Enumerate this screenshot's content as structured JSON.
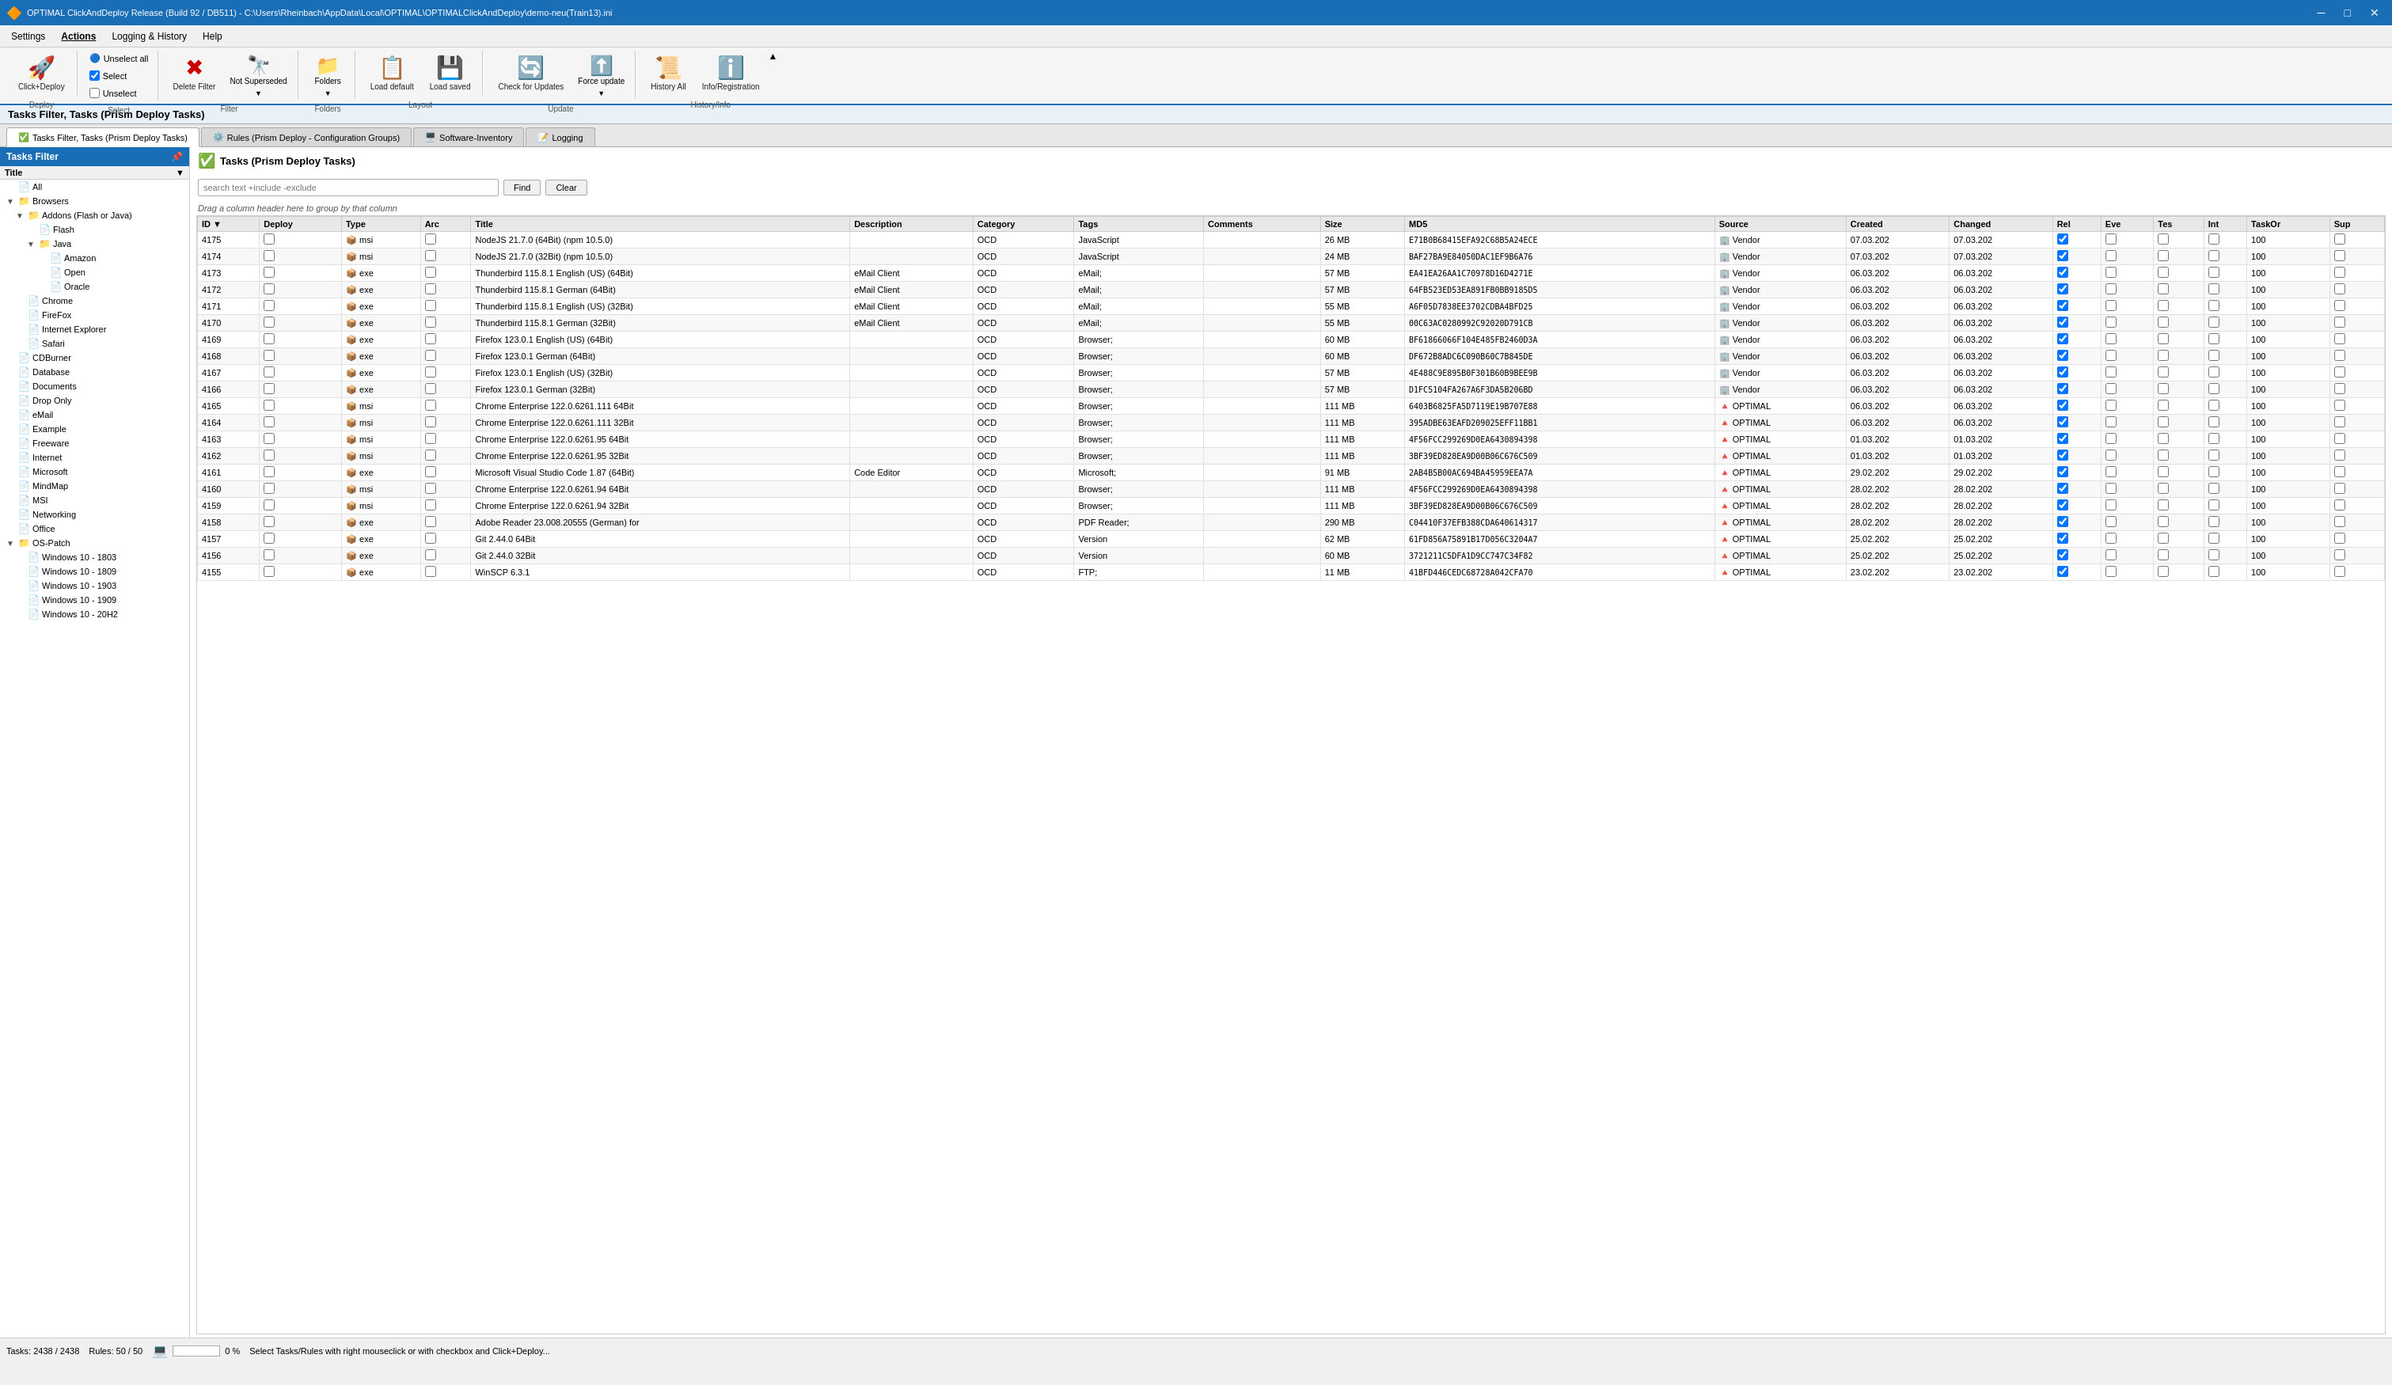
{
  "titlebar": {
    "icon": "🔶",
    "text": "OPTIMAL ClickAndDeploy Release (Build 92 / DB511) - C:\\Users\\Rheinbach\\AppData\\Local\\OPTIMAL\\OPTIMALClickAndDeploy\\demo-neu(Train13).ini",
    "minimize": "─",
    "maximize": "□",
    "close": "✕"
  },
  "menubar": {
    "items": [
      "Settings",
      "Actions",
      "Logging & History",
      "Help"
    ]
  },
  "toolbar": {
    "deploy_label": "Click+Deploy",
    "unselect_all_label": "Unselect all",
    "select_label": "Select",
    "unselect_label": "Unselect",
    "delete_filter_label": "Delete Filter",
    "not_superseded_label": "Not Superseded",
    "folders_label": "Folders",
    "load_default_label": "Load default",
    "load_saved_label": "Load saved",
    "check_updates_label": "Check for Updates",
    "force_update_label": "Force update",
    "history_all_label": "History All",
    "info_registration_label": "Info/Registration",
    "group_deploy": "Deploy",
    "group_select": "Select",
    "group_filter": "Filter",
    "group_folders": "Folders",
    "group_layout": "Layout",
    "group_update": "Update",
    "group_history_info": "History/Info"
  },
  "page_title": "Tasks Filter, Tasks (Prism Deploy Tasks)",
  "tabs": [
    {
      "label": "Tasks Filter, Tasks (Prism Deploy Tasks)",
      "active": true
    },
    {
      "label": "Rules (Prism Deploy - Configuration Groups)",
      "active": false
    },
    {
      "label": "Software-Inventory",
      "active": false
    },
    {
      "label": "Logging",
      "active": false
    }
  ],
  "sidebar": {
    "title": "Tasks Filter",
    "title_column": "Title",
    "items": [
      {
        "label": "All",
        "indent": 0,
        "type": "item"
      },
      {
        "label": "Browsers",
        "indent": 0,
        "type": "folder",
        "expanded": true
      },
      {
        "label": "Addons (Flash or Java)",
        "indent": 1,
        "type": "folder",
        "expanded": true
      },
      {
        "label": "Flash",
        "indent": 2,
        "type": "item"
      },
      {
        "label": "Java",
        "indent": 2,
        "type": "folder",
        "expanded": true
      },
      {
        "label": "Amazon",
        "indent": 3,
        "type": "item"
      },
      {
        "label": "Open",
        "indent": 3,
        "type": "item"
      },
      {
        "label": "Oracle",
        "indent": 3,
        "type": "item"
      },
      {
        "label": "Chrome",
        "indent": 1,
        "type": "item"
      },
      {
        "label": "FireFox",
        "indent": 1,
        "type": "item"
      },
      {
        "label": "Internet Explorer",
        "indent": 1,
        "type": "item"
      },
      {
        "label": "Safari",
        "indent": 1,
        "type": "item"
      },
      {
        "label": "CDBurner",
        "indent": 0,
        "type": "item"
      },
      {
        "label": "Database",
        "indent": 0,
        "type": "item"
      },
      {
        "label": "Documents",
        "indent": 0,
        "type": "item"
      },
      {
        "label": "Drop Only",
        "indent": 0,
        "type": "item"
      },
      {
        "label": "eMail",
        "indent": 0,
        "type": "item"
      },
      {
        "label": "Example",
        "indent": 0,
        "type": "item"
      },
      {
        "label": "Freeware",
        "indent": 0,
        "type": "item"
      },
      {
        "label": "Internet",
        "indent": 0,
        "type": "item"
      },
      {
        "label": "Microsoft",
        "indent": 0,
        "type": "item"
      },
      {
        "label": "MindMap",
        "indent": 0,
        "type": "item"
      },
      {
        "label": "MSI",
        "indent": 0,
        "type": "item"
      },
      {
        "label": "Networking",
        "indent": 0,
        "type": "item"
      },
      {
        "label": "Office",
        "indent": 0,
        "type": "item"
      },
      {
        "label": "OS-Patch",
        "indent": 0,
        "type": "folder",
        "expanded": true
      },
      {
        "label": "Windows 10 - 1803",
        "indent": 1,
        "type": "item"
      },
      {
        "label": "Windows 10 - 1809",
        "indent": 1,
        "type": "item"
      },
      {
        "label": "Windows 10 - 1903",
        "indent": 1,
        "type": "item"
      },
      {
        "label": "Windows 10 - 1909",
        "indent": 1,
        "type": "item"
      },
      {
        "label": "Windows 10 - 20H2",
        "indent": 1,
        "type": "item"
      }
    ]
  },
  "search": {
    "placeholder": "search text +include -exclude",
    "find_label": "Find",
    "clear_label": "Clear"
  },
  "drag_hint": "Drag a column header here to group by that column",
  "table": {
    "columns": [
      "ID",
      "Deploy",
      "Type",
      "Arc",
      "Title",
      "Description",
      "Category",
      "Tags",
      "Comments",
      "Size",
      "MD5",
      "Source",
      "Created",
      "Changed",
      "Rel",
      "Eve",
      "Tes",
      "Int",
      "TaskOr",
      "Sup"
    ],
    "rows": [
      {
        "id": "4175",
        "deploy": "",
        "type": "msi",
        "arc": "",
        "title": "NodeJS 21.7.0 (64Bit) (npm 10.5.0)",
        "desc": "",
        "cat": "OCD",
        "tags": "JavaScript",
        "comments": "",
        "size": "26 MB",
        "md5": "E71B0B68415EFA92C68B5A24ECE",
        "source": "Vendor",
        "created": "07.03.202",
        "changed": "07.03.202",
        "rel": "✓",
        "eve": "",
        "tes": "",
        "int": "",
        "taskor": "100",
        "sup": ""
      },
      {
        "id": "4174",
        "deploy": "",
        "type": "msi",
        "arc": "",
        "title": "NodeJS 21.7.0 (32Bit) (npm 10.5.0)",
        "desc": "",
        "cat": "OCD",
        "tags": "JavaScript",
        "comments": "",
        "size": "24 MB",
        "md5": "BAF27BA9E84050DAC1EF9B6A76",
        "source": "Vendor",
        "created": "07.03.202",
        "changed": "07.03.202",
        "rel": "✓",
        "eve": "",
        "tes": "",
        "int": "",
        "taskor": "100",
        "sup": ""
      },
      {
        "id": "4173",
        "deploy": "",
        "type": "exe",
        "arc": "",
        "title": "Thunderbird 115.8.1 English (US) (64Bit)",
        "desc": "eMail Client",
        "cat": "OCD",
        "tags": "eMail;",
        "comments": "",
        "size": "57 MB",
        "md5": "EA41EA26AA1C70978D16D4271E",
        "source": "Vendor",
        "created": "06.03.202",
        "changed": "06.03.202",
        "rel": "✓",
        "eve": "",
        "tes": "",
        "int": "",
        "taskor": "100",
        "sup": ""
      },
      {
        "id": "4172",
        "deploy": "",
        "type": "exe",
        "arc": "",
        "title": "Thunderbird 115.8.1 German (64Bit)",
        "desc": "eMail Client",
        "cat": "OCD",
        "tags": "eMail;",
        "comments": "",
        "size": "57 MB",
        "md5": "64FB523ED53EA891FB0BB9185D5",
        "source": "Vendor",
        "created": "06.03.202",
        "changed": "06.03.202",
        "rel": "✓",
        "eve": "",
        "tes": "",
        "int": "",
        "taskor": "100",
        "sup": ""
      },
      {
        "id": "4171",
        "deploy": "",
        "type": "exe",
        "arc": "",
        "title": "Thunderbird 115.8.1 English (US) (32Bit)",
        "desc": "eMail Client",
        "cat": "OCD",
        "tags": "eMail;",
        "comments": "",
        "size": "55 MB",
        "md5": "A6F05D7838EE3702CDBA4BFD25",
        "source": "Vendor",
        "created": "06.03.202",
        "changed": "06.03.202",
        "rel": "✓",
        "eve": "",
        "tes": "",
        "int": "",
        "taskor": "100",
        "sup": ""
      },
      {
        "id": "4170",
        "deploy": "",
        "type": "exe",
        "arc": "",
        "title": "Thunderbird 115.8.1 German (32Bit)",
        "desc": "eMail Client",
        "cat": "OCD",
        "tags": "eMail;",
        "comments": "",
        "size": "55 MB",
        "md5": "00C63AC0280992C92020D791CB",
        "source": "Vendor",
        "created": "06.03.202",
        "changed": "06.03.202",
        "rel": "✓",
        "eve": "",
        "tes": "",
        "int": "",
        "taskor": "100",
        "sup": ""
      },
      {
        "id": "4169",
        "deploy": "",
        "type": "exe",
        "arc": "",
        "title": "Firefox 123.0.1 English (US) (64Bit)",
        "desc": "",
        "cat": "OCD",
        "tags": "Browser;",
        "comments": "",
        "size": "60 MB",
        "md5": "BF61866066F104E485FB2460D3A",
        "source": "Vendor",
        "created": "06.03.202",
        "changed": "06.03.202",
        "rel": "✓",
        "eve": "",
        "tes": "",
        "int": "",
        "taskor": "100",
        "sup": ""
      },
      {
        "id": "4168",
        "deploy": "",
        "type": "exe",
        "arc": "",
        "title": "Firefox 123.0.1 German (64Bit)",
        "desc": "",
        "cat": "OCD",
        "tags": "Browser;",
        "comments": "",
        "size": "60 MB",
        "md5": "DF672B8ADC6C090B60C7B845DE",
        "source": "Vendor",
        "created": "06.03.202",
        "changed": "06.03.202",
        "rel": "✓",
        "eve": "",
        "tes": "",
        "int": "",
        "taskor": "100",
        "sup": ""
      },
      {
        "id": "4167",
        "deploy": "",
        "type": "exe",
        "arc": "",
        "title": "Firefox 123.0.1 English (US) (32Bit)",
        "desc": "",
        "cat": "OCD",
        "tags": "Browser;",
        "comments": "",
        "size": "57 MB",
        "md5": "4E488C9E895B0F301B60B9BEE9B",
        "source": "Vendor",
        "created": "06.03.202",
        "changed": "06.03.202",
        "rel": "✓",
        "eve": "",
        "tes": "",
        "int": "",
        "taskor": "100",
        "sup": ""
      },
      {
        "id": "4166",
        "deploy": "",
        "type": "exe",
        "arc": "",
        "title": "Firefox 123.0.1 German (32Bit)",
        "desc": "",
        "cat": "OCD",
        "tags": "Browser;",
        "comments": "",
        "size": "57 MB",
        "md5": "D1FC5104FA267A6F3DA5B206BD",
        "source": "Vendor",
        "created": "06.03.202",
        "changed": "06.03.202",
        "rel": "✓",
        "eve": "",
        "tes": "",
        "int": "",
        "taskor": "100",
        "sup": ""
      },
      {
        "id": "4165",
        "deploy": "",
        "type": "msi",
        "arc": "",
        "title": "Chrome Enterprise 122.0.6261.111 64Bit",
        "desc": "",
        "cat": "OCD",
        "tags": "Browser;",
        "comments": "",
        "size": "111 MB",
        "md5": "6403B6825FA5D7119E19B707E88",
        "source": "OPTIMAL",
        "created": "06.03.202",
        "changed": "06.03.202",
        "rel": "✓",
        "eve": "",
        "tes": "",
        "int": "",
        "taskor": "100",
        "sup": ""
      },
      {
        "id": "4164",
        "deploy": "",
        "type": "msi",
        "arc": "",
        "title": "Chrome Enterprise 122.0.6261.111 32Bit",
        "desc": "",
        "cat": "OCD",
        "tags": "Browser;",
        "comments": "",
        "size": "111 MB",
        "md5": "395ADBE63EAFD209025EFF11BB1",
        "source": "OPTIMAL",
        "created": "06.03.202",
        "changed": "06.03.202",
        "rel": "✓",
        "eve": "",
        "tes": "",
        "int": "",
        "taskor": "100",
        "sup": ""
      },
      {
        "id": "4163",
        "deploy": "",
        "type": "msi",
        "arc": "",
        "title": "Chrome Enterprise 122.0.6261.95 64Bit",
        "desc": "",
        "cat": "OCD",
        "tags": "Browser;",
        "comments": "",
        "size": "111 MB",
        "md5": "4F56FCC299269D0EA6430894398",
        "source": "OPTIMAL",
        "created": "01.03.202",
        "changed": "01.03.202",
        "rel": "✓",
        "eve": "",
        "tes": "",
        "int": "",
        "taskor": "100",
        "sup": ""
      },
      {
        "id": "4162",
        "deploy": "",
        "type": "msi",
        "arc": "",
        "title": "Chrome Enterprise 122.0.6261.95 32Bit",
        "desc": "",
        "cat": "OCD",
        "tags": "Browser;",
        "comments": "",
        "size": "111 MB",
        "md5": "3BF39ED828EA9D00B06C676C509",
        "source": "OPTIMAL",
        "created": "01.03.202",
        "changed": "01.03.202",
        "rel": "✓",
        "eve": "",
        "tes": "",
        "int": "",
        "taskor": "100",
        "sup": ""
      },
      {
        "id": "4161",
        "deploy": "",
        "type": "exe",
        "arc": "",
        "title": "Microsoft Visual Studio Code 1.87 (64Bit)",
        "desc": "Code Editor",
        "cat": "OCD",
        "tags": "Microsoft;",
        "comments": "",
        "size": "91 MB",
        "md5": "2AB4B5B00AC694BA45959EEA7A",
        "source": "OPTIMAL",
        "created": "29.02.202",
        "changed": "29.02.202",
        "rel": "✓",
        "eve": "",
        "tes": "",
        "int": "",
        "taskor": "100",
        "sup": ""
      },
      {
        "id": "4160",
        "deploy": "",
        "type": "msi",
        "arc": "",
        "title": "Chrome Enterprise 122.0.6261.94 64Bit",
        "desc": "",
        "cat": "OCD",
        "tags": "Browser;",
        "comments": "",
        "size": "111 MB",
        "md5": "4F56FCC299269D0EA6430894398",
        "source": "OPTIMAL",
        "created": "28.02.202",
        "changed": "28.02.202",
        "rel": "✓",
        "eve": "",
        "tes": "",
        "int": "",
        "taskor": "100",
        "sup": ""
      },
      {
        "id": "4159",
        "deploy": "",
        "type": "msi",
        "arc": "",
        "title": "Chrome Enterprise 122.0.6261.94 32Bit",
        "desc": "",
        "cat": "OCD",
        "tags": "Browser;",
        "comments": "",
        "size": "111 MB",
        "md5": "3BF39ED828EA9D00B06C676C509",
        "source": "OPTIMAL",
        "created": "28.02.202",
        "changed": "28.02.202",
        "rel": "✓",
        "eve": "",
        "tes": "",
        "int": "",
        "taskor": "100",
        "sup": ""
      },
      {
        "id": "4158",
        "deploy": "",
        "type": "exe",
        "arc": "",
        "title": "Adobe Reader 23.008.20555 (German) for",
        "desc": "",
        "cat": "OCD",
        "tags": "PDF Reader;",
        "comments": "",
        "size": "290 MB",
        "md5": "C04410F37EFB388CDA640614317",
        "source": "OPTIMAL",
        "created": "28.02.202",
        "changed": "28.02.202",
        "rel": "✓",
        "eve": "",
        "tes": "",
        "int": "",
        "taskor": "100",
        "sup": ""
      },
      {
        "id": "4157",
        "deploy": "",
        "type": "exe",
        "arc": "",
        "title": "Git 2.44.0 64Bit",
        "desc": "",
        "cat": "OCD",
        "tags": "Version",
        "comments": "",
        "size": "62 MB",
        "md5": "61FD856A75891B17D056C3204A7",
        "source": "OPTIMAL",
        "created": "25.02.202",
        "changed": "25.02.202",
        "rel": "✓",
        "eve": "",
        "tes": "",
        "int": "",
        "taskor": "100",
        "sup": ""
      },
      {
        "id": "4156",
        "deploy": "",
        "type": "exe",
        "arc": "",
        "title": "Git 2.44.0 32Bit",
        "desc": "",
        "cat": "OCD",
        "tags": "Version",
        "comments": "",
        "size": "60 MB",
        "md5": "3721211C5DFA1D9CC747C34F82",
        "source": "OPTIMAL",
        "created": "25.02.202",
        "changed": "25.02.202",
        "rel": "✓",
        "eve": "",
        "tes": "",
        "int": "",
        "taskor": "100",
        "sup": ""
      },
      {
        "id": "4155",
        "deploy": "",
        "type": "exe",
        "arc": "",
        "title": "WinSCP 6.3.1",
        "desc": "",
        "cat": "OCD",
        "tags": "FTP;",
        "comments": "",
        "size": "11 MB",
        "md5": "41BFD446CEDC68728A042CFA70",
        "source": "OPTIMAL",
        "created": "23.02.202",
        "changed": "23.02.202",
        "rel": "✓",
        "eve": "",
        "tes": "",
        "int": "",
        "taskor": "100",
        "sup": ""
      }
    ]
  },
  "statusbar": {
    "tasks": "Tasks: 2438 / 2438",
    "rules": "Rules: 50 / 50",
    "progress_pct": "0 %",
    "status_text": "Select Tasks/Rules with right mouseclick or with checkbox and Click+Deploy..."
  }
}
